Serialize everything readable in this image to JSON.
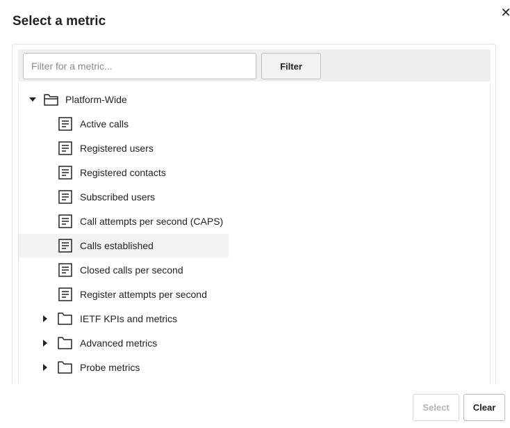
{
  "dialog": {
    "title": "Select a metric",
    "close_icon": "close-icon"
  },
  "filter": {
    "placeholder": "Filter for a metric...",
    "value": "",
    "button_label": "Filter"
  },
  "tree": {
    "root": {
      "label": "Platform-Wide",
      "expanded": true,
      "icon": "folder-open-icon"
    },
    "metrics": [
      {
        "label": "Active calls",
        "icon": "document-icon"
      },
      {
        "label": "Registered users",
        "icon": "document-icon"
      },
      {
        "label": "Registered contacts",
        "icon": "document-icon"
      },
      {
        "label": "Subscribed users",
        "icon": "document-icon"
      },
      {
        "label": "Call attempts per second (CAPS)",
        "icon": "document-icon"
      },
      {
        "label": "Calls established",
        "icon": "document-icon",
        "highlighted": true
      },
      {
        "label": "Closed calls per second",
        "icon": "document-icon"
      },
      {
        "label": "Register attempts per second",
        "icon": "document-icon"
      }
    ],
    "folders": [
      {
        "label": "IETF KPIs and metrics",
        "expanded": false,
        "icon": "folder-icon"
      },
      {
        "label": "Advanced metrics",
        "expanded": false,
        "icon": "folder-icon"
      },
      {
        "label": "Probe metrics",
        "expanded": false,
        "icon": "folder-icon"
      }
    ]
  },
  "footer": {
    "select_label": "Select",
    "select_disabled": true,
    "clear_label": "Clear"
  },
  "colors": {
    "highlight_row": "#f3f3f3",
    "filter_bar": "#efefef",
    "disabled_text": "#b3b3b3"
  }
}
